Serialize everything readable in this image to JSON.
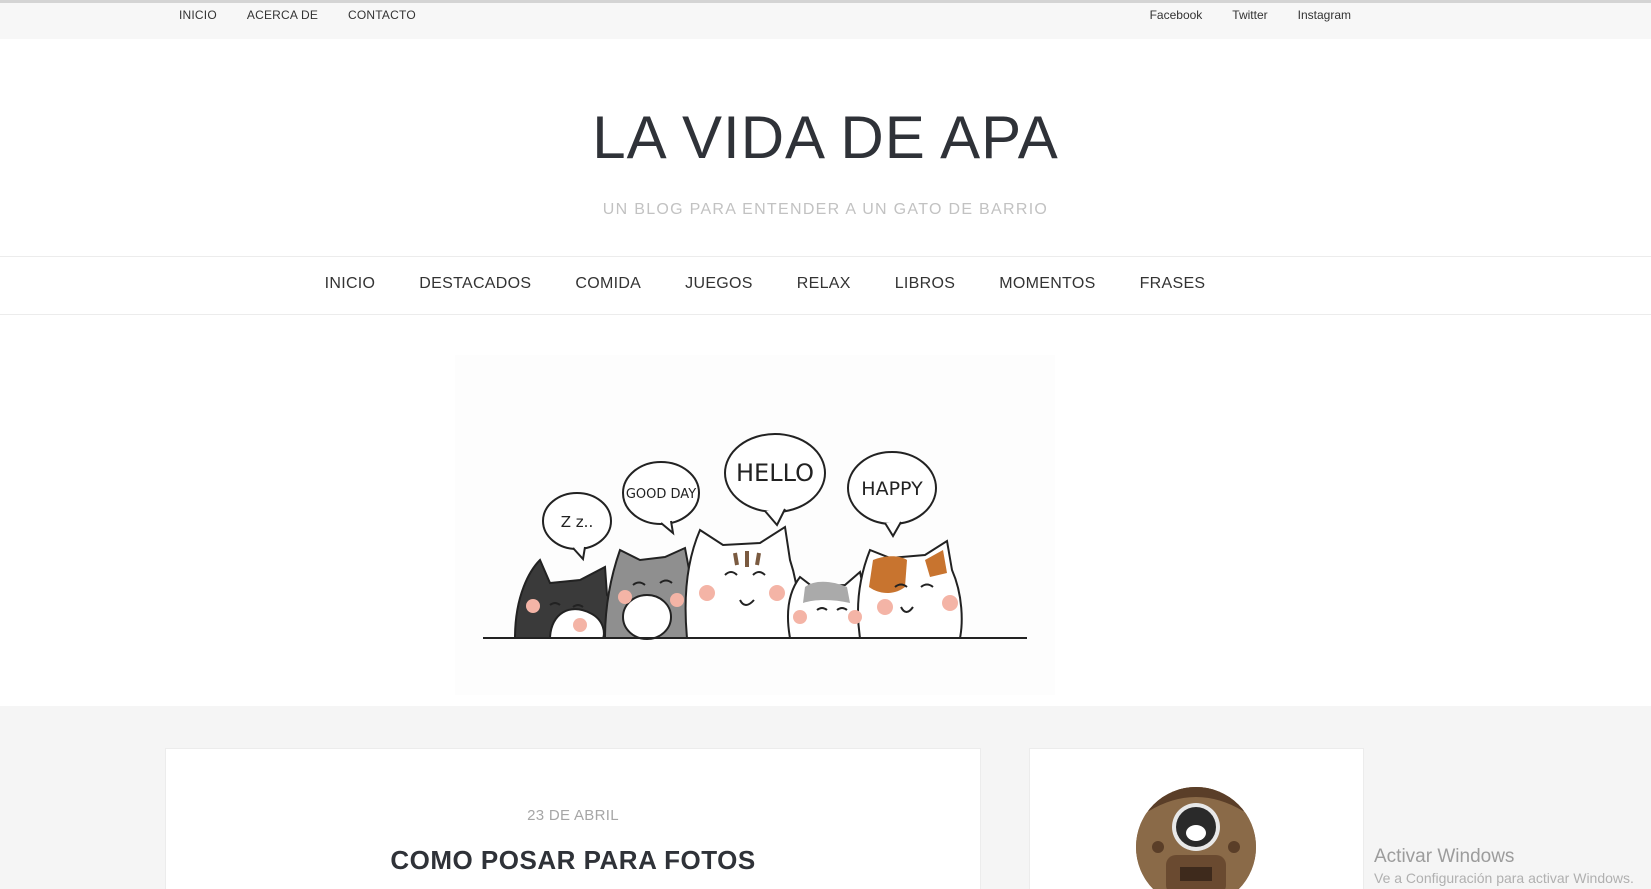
{
  "topbar": {
    "left_links": [
      "INICIO",
      "ACERCA DE",
      "CONTACTO"
    ],
    "right_links": [
      "Facebook",
      "Twitter",
      "Instagram"
    ]
  },
  "header": {
    "title": "LA VIDA DE APA",
    "tagline": "UN BLOG PARA ENTENDER A UN GATO DE BARRIO"
  },
  "nav": {
    "items": [
      "INICIO",
      "DESTACADOS",
      "COMIDA",
      "JUEGOS",
      "RELAX",
      "LIBROS",
      "MOMENTOS",
      "FRASES"
    ]
  },
  "hero": {
    "bubbles": [
      "Z z..",
      "GOOD DAY",
      "HELLO",
      "HAPPY"
    ]
  },
  "post": {
    "date": "23 DE ABRIL",
    "title": "COMO POSAR PARA FOTOS"
  },
  "watermark": {
    "line1": "Activar Windows",
    "line2": "Ve a Configuración para activar Windows."
  }
}
